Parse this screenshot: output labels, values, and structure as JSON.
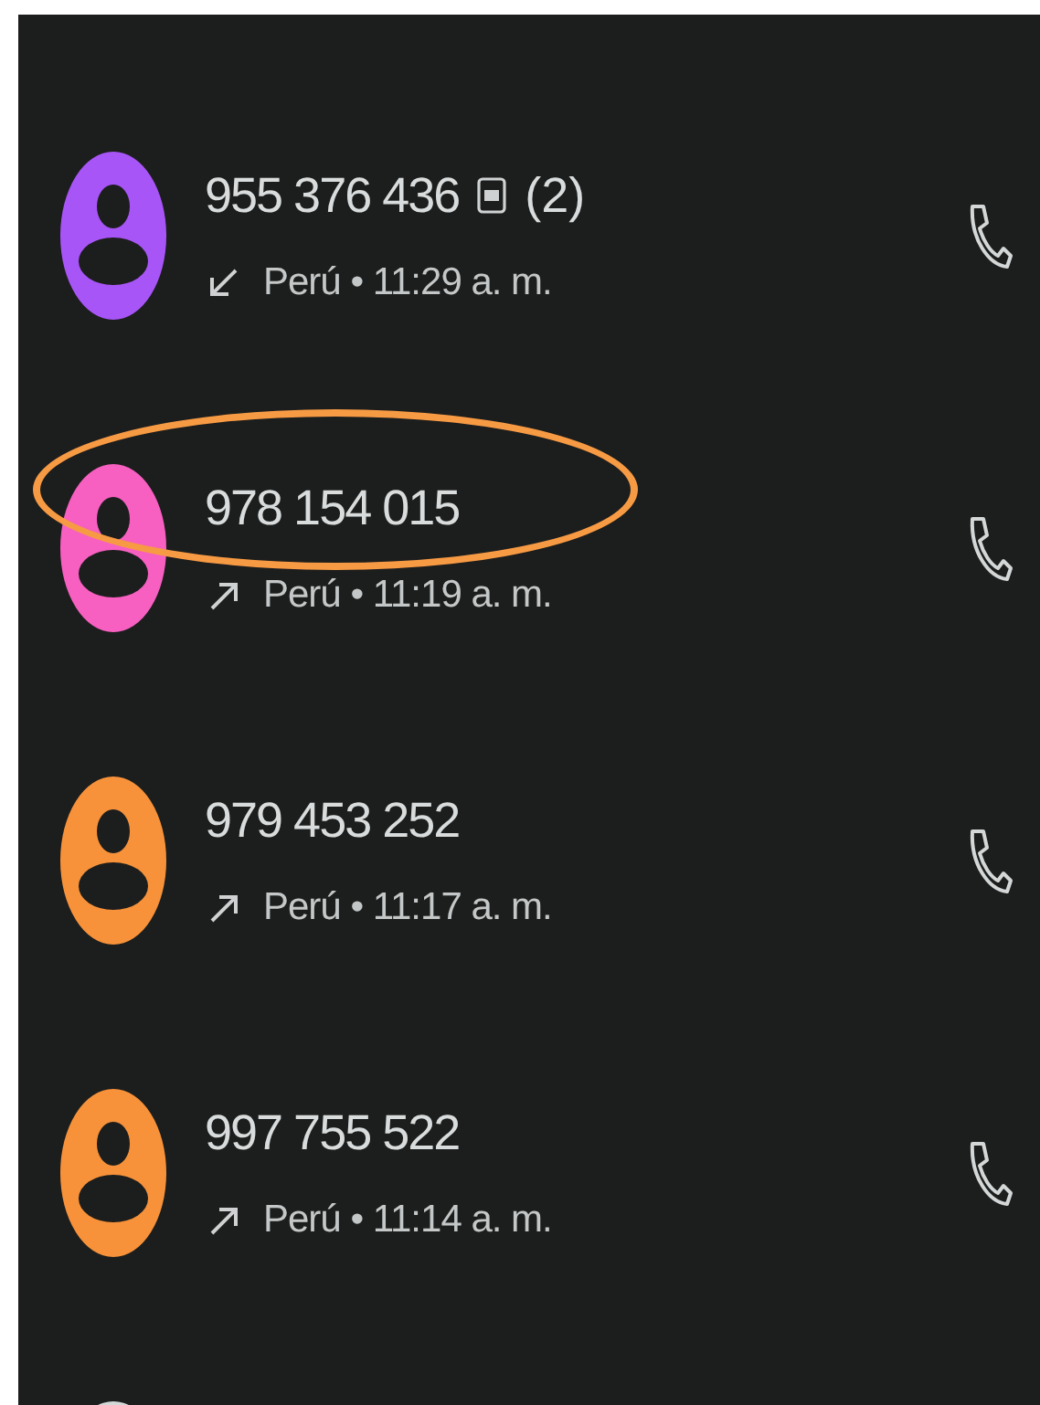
{
  "calls": [
    {
      "number": "955 376 436",
      "hd": true,
      "count": "(2)",
      "kind": "incoming",
      "meta": "Perú • 11:29 a. m.",
      "color": "#a855f7"
    },
    {
      "number": "978 154 015",
      "kind": "outgoing",
      "meta": "Perú • 11:19 a. m.",
      "color": "#f75fc0",
      "circled": true
    },
    {
      "number": "979 453 252",
      "kind": "outgoing",
      "meta": "Perú • 11:17 a. m.",
      "color": "#f7923a"
    },
    {
      "number": "997 755 522",
      "kind": "outgoing",
      "meta": "Perú • 11:14 a. m.",
      "color": "#f7923a"
    },
    {
      "color": "#d3d8d8"
    }
  ]
}
